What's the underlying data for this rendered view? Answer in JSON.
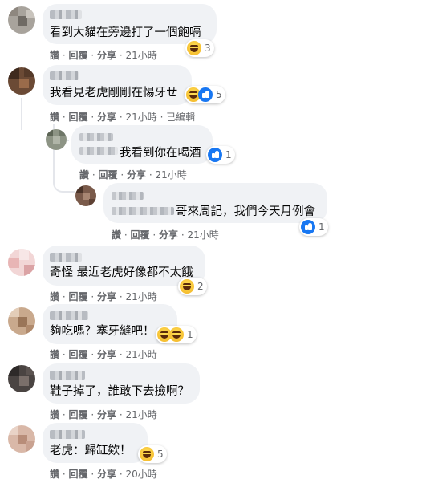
{
  "comments": [
    {
      "text": "看到大貓在旁邊打了一個飽嗝",
      "reaction_count": "3",
      "actions": {
        "like": "讚",
        "reply": "回覆",
        "share": "分享",
        "time": "21小時"
      }
    },
    {
      "text": "我看見老虎剛剛在惕牙ㄝ",
      "reaction_count": "5",
      "actions": {
        "like": "讚",
        "reply": "回覆",
        "share": "分享",
        "time": "21小時",
        "edited": "已編輯"
      }
    },
    {
      "text": "我看到你在喝酒",
      "reaction_count": "1",
      "actions": {
        "like": "讚",
        "reply": "回覆",
        "share": "分享",
        "time": "21小時"
      }
    },
    {
      "text": "哥來周記，我們今天月例會",
      "reaction_count": "1",
      "actions": {
        "like": "讚",
        "reply": "回覆",
        "share": "分享",
        "time": "21小時"
      }
    },
    {
      "text": "奇怪 最近老虎好像都不太餓",
      "reaction_count": "2",
      "actions": {
        "like": "讚",
        "reply": "回覆",
        "share": "分享",
        "time": "21小時"
      }
    },
    {
      "text": "夠吃嗎？塞牙縫吧！",
      "reaction_count": "1",
      "actions": {
        "like": "讚",
        "reply": "回覆",
        "share": "分享",
        "time": "21小時"
      }
    },
    {
      "text": "鞋子掉了，誰敢下去撿啊？",
      "reaction_count": "",
      "actions": {
        "like": "讚",
        "reply": "回覆",
        "share": "分享",
        "time": "21小時"
      }
    },
    {
      "text": "老虎：歸缸欸！",
      "reaction_count": "5",
      "actions": {
        "like": "讚",
        "reply": "回覆",
        "share": "分享",
        "time": "20小時"
      }
    }
  ],
  "separator": "·",
  "icons": {
    "haha": "haha-reaction-icon",
    "like": "like-reaction-icon"
  },
  "colors": {
    "bubble": "#f0f2f5",
    "meta": "#65676b",
    "like": "#1877f2"
  }
}
